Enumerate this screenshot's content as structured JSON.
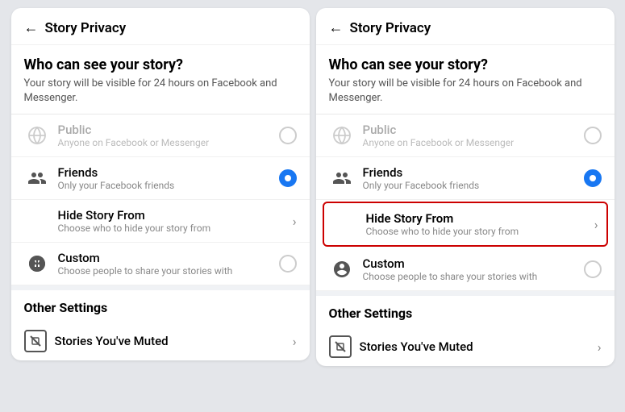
{
  "left_panel": {
    "header": {
      "back_label": "←",
      "title": "Story Privacy"
    },
    "who_can_see": {
      "heading": "Who can see your story?",
      "subtitle": "Your story will be visible for 24 hours on Facebook and Messenger."
    },
    "options": [
      {
        "id": "public",
        "label": "Public",
        "sublabel": "Anyone on Facebook or Messenger",
        "type": "radio",
        "selected": false,
        "disabled": true,
        "has_icon": true,
        "icon_type": "globe"
      },
      {
        "id": "friends",
        "label": "Friends",
        "sublabel": "Only your Facebook friends",
        "type": "radio",
        "selected": true,
        "disabled": false,
        "has_icon": true,
        "icon_type": "friends"
      },
      {
        "id": "hide_story",
        "label": "Hide Story From",
        "sublabel": "Choose who to hide your story from",
        "type": "chevron",
        "selected": false,
        "disabled": false,
        "has_icon": false
      },
      {
        "id": "custom",
        "label": "Custom",
        "sublabel": "Choose people to share your stories with",
        "type": "radio",
        "selected": false,
        "disabled": false,
        "has_icon": true,
        "icon_type": "custom"
      }
    ],
    "other_settings": {
      "heading": "Other Settings",
      "items": [
        {
          "id": "muted_stories",
          "label": "Stories You've Muted",
          "type": "chevron"
        }
      ]
    }
  },
  "right_panel": {
    "header": {
      "back_label": "←",
      "title": "Story Privacy"
    },
    "who_can_see": {
      "heading": "Who can see your story?",
      "subtitle": "Your story will be visible for 24 hours on Facebook and Messenger."
    },
    "options": [
      {
        "id": "public",
        "label": "Public",
        "sublabel": "Anyone on Facebook or Messenger",
        "type": "radio",
        "selected": false,
        "disabled": true,
        "has_icon": true,
        "icon_type": "globe"
      },
      {
        "id": "friends",
        "label": "Friends",
        "sublabel": "Only your Facebook friends",
        "type": "radio",
        "selected": true,
        "disabled": false,
        "has_icon": true,
        "icon_type": "friends"
      },
      {
        "id": "hide_story",
        "label": "Hide Story From",
        "sublabel": "Choose who to hide your story from",
        "type": "chevron",
        "selected": false,
        "disabled": false,
        "highlighted": true,
        "has_icon": false
      },
      {
        "id": "custom",
        "label": "Custom",
        "sublabel": "Choose people to share your stories with",
        "type": "radio",
        "selected": false,
        "disabled": false,
        "has_icon": true,
        "icon_type": "custom"
      }
    ],
    "other_settings": {
      "heading": "Other Settings",
      "items": [
        {
          "id": "muted_stories",
          "label": "Stories You've Muted",
          "type": "chevron"
        }
      ]
    }
  }
}
